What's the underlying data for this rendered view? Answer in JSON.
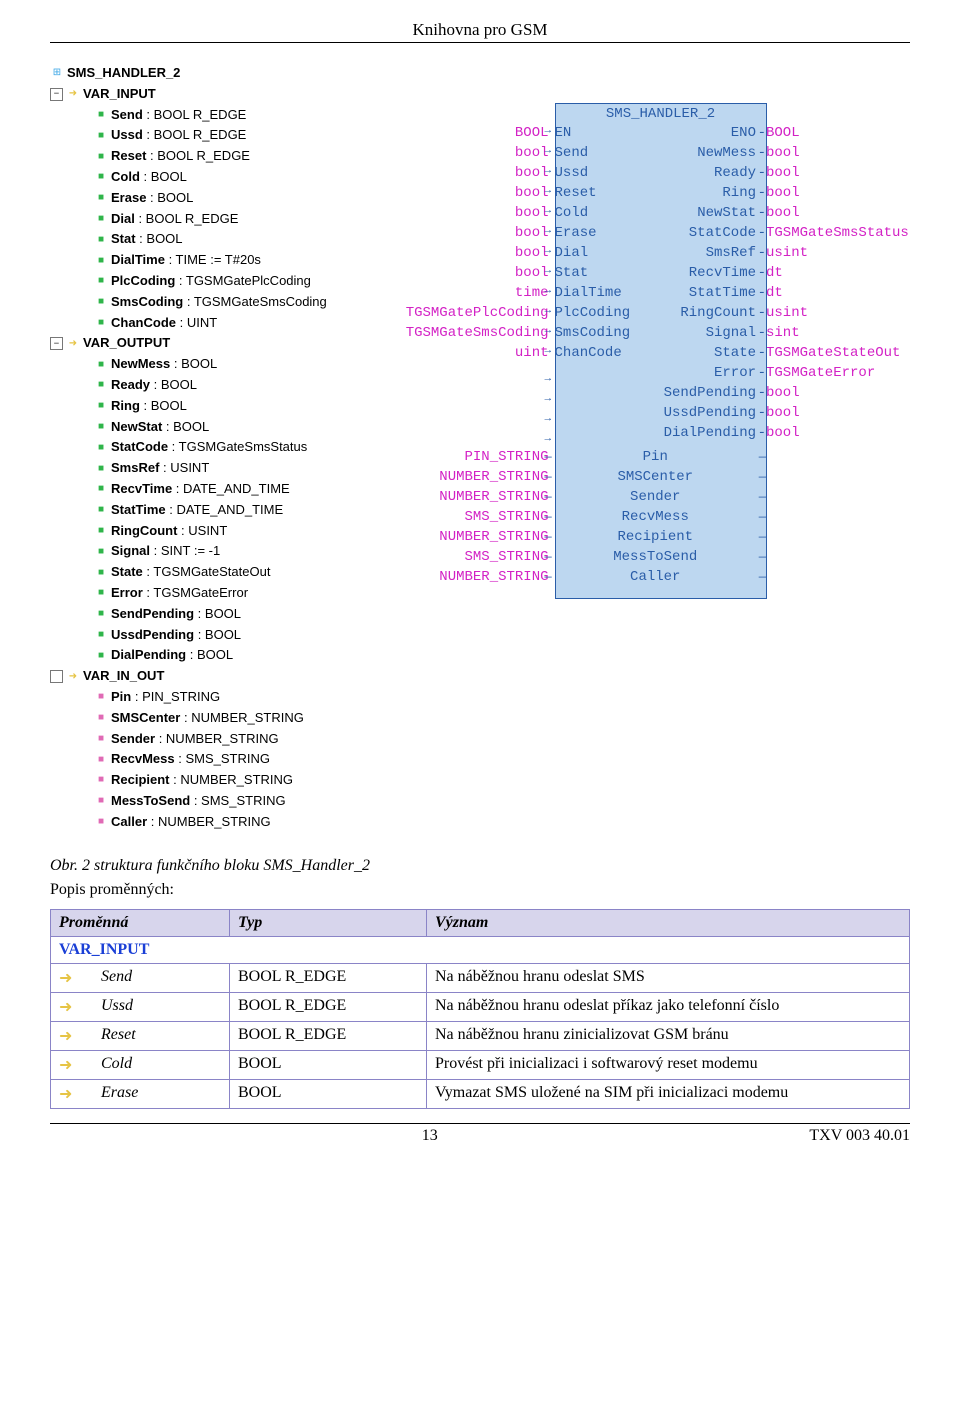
{
  "header": "Knihovna pro GSM",
  "tree": {
    "root": "SMS_HANDLER_2",
    "sections": [
      {
        "label": "VAR_INPUT",
        "items": [
          {
            "name": "Send",
            "type": "BOOL R_EDGE"
          },
          {
            "name": "Ussd",
            "type": "BOOL R_EDGE"
          },
          {
            "name": "Reset",
            "type": "BOOL R_EDGE"
          },
          {
            "name": "Cold",
            "type": "BOOL"
          },
          {
            "name": "Erase",
            "type": "BOOL"
          },
          {
            "name": "Dial",
            "type": "BOOL R_EDGE"
          },
          {
            "name": "Stat",
            "type": "BOOL"
          },
          {
            "name": "DialTime",
            "type": "TIME := T#20s"
          },
          {
            "name": "PlcCoding",
            "type": "TGSMGatePlcCoding"
          },
          {
            "name": "SmsCoding",
            "type": "TGSMGateSmsCoding"
          },
          {
            "name": "ChanCode",
            "type": "UINT"
          }
        ]
      },
      {
        "label": "VAR_OUTPUT",
        "items": [
          {
            "name": "NewMess",
            "type": "BOOL"
          },
          {
            "name": "Ready",
            "type": "BOOL"
          },
          {
            "name": "Ring",
            "type": "BOOL"
          },
          {
            "name": "NewStat",
            "type": "BOOL"
          },
          {
            "name": "StatCode",
            "type": "TGSMGateSmsStatus"
          },
          {
            "name": "SmsRef",
            "type": "USINT"
          },
          {
            "name": "RecvTime",
            "type": "DATE_AND_TIME"
          },
          {
            "name": "StatTime",
            "type": "DATE_AND_TIME"
          },
          {
            "name": "RingCount",
            "type": "USINT"
          },
          {
            "name": "Signal",
            "type": "SINT := -1"
          },
          {
            "name": "State",
            "type": "TGSMGateStateOut"
          },
          {
            "name": "Error",
            "type": "TGSMGateError"
          },
          {
            "name": "SendPending",
            "type": "BOOL"
          },
          {
            "name": "UssdPending",
            "type": "BOOL"
          },
          {
            "name": "DialPending",
            "type": "BOOL"
          }
        ]
      },
      {
        "label": "VAR_IN_OUT",
        "items": [
          {
            "name": "Pin",
            "type": "PIN_STRING"
          },
          {
            "name": "SMSCenter",
            "type": "NUMBER_STRING"
          },
          {
            "name": "Sender",
            "type": "NUMBER_STRING"
          },
          {
            "name": "RecvMess",
            "type": "SMS_STRING"
          },
          {
            "name": "Recipient",
            "type": "NUMBER_STRING"
          },
          {
            "name": "MessToSend",
            "type": "SMS_STRING"
          },
          {
            "name": "Caller",
            "type": "NUMBER_STRING"
          }
        ]
      }
    ]
  },
  "block": {
    "title": "SMS_HANDLER_2",
    "inputs": [
      {
        "type": "BOOL",
        "name": "EN"
      },
      {
        "type": "bool",
        "name": "Send"
      },
      {
        "type": "bool",
        "name": "Ussd"
      },
      {
        "type": "bool",
        "name": "Reset"
      },
      {
        "type": "bool",
        "name": "Cold"
      },
      {
        "type": "bool",
        "name": "Erase"
      },
      {
        "type": "bool",
        "name": "Dial"
      },
      {
        "type": "bool",
        "name": "Stat"
      },
      {
        "type": "time",
        "name": "DialTime"
      },
      {
        "type": "TGSMGatePlcCoding",
        "name": "PlcCoding"
      },
      {
        "type": "TGSMGateSmsCoding",
        "name": "SmsCoding"
      },
      {
        "type": "uint",
        "name": "ChanCode"
      }
    ],
    "outputs": [
      {
        "name": "ENO",
        "type": "BOOL"
      },
      {
        "name": "NewMess",
        "type": "bool"
      },
      {
        "name": "Ready",
        "type": "bool"
      },
      {
        "name": "Ring",
        "type": "bool"
      },
      {
        "name": "NewStat",
        "type": "bool"
      },
      {
        "name": "StatCode",
        "type": "TGSMGateSmsStatus"
      },
      {
        "name": "SmsRef",
        "type": "usint"
      },
      {
        "name": "RecvTime",
        "type": "dt"
      },
      {
        "name": "StatTime",
        "type": "dt"
      },
      {
        "name": "RingCount",
        "type": "usint"
      },
      {
        "name": "Signal",
        "type": "sint"
      },
      {
        "name": "State",
        "type": "TGSMGateStateOut"
      },
      {
        "name": "Error",
        "type": "TGSMGateError"
      },
      {
        "name": "SendPending",
        "type": "bool"
      },
      {
        "name": "UssdPending",
        "type": "bool"
      },
      {
        "name": "DialPending",
        "type": "bool"
      }
    ],
    "inouts": [
      {
        "type": "PIN_STRING",
        "name": "Pin"
      },
      {
        "type": "NUMBER_STRING",
        "name": "SMSCenter"
      },
      {
        "type": "NUMBER_STRING",
        "name": "Sender"
      },
      {
        "type": "SMS_STRING",
        "name": "RecvMess"
      },
      {
        "type": "NUMBER_STRING",
        "name": "Recipient"
      },
      {
        "type": "SMS_STRING",
        "name": "MessToSend"
      },
      {
        "type": "NUMBER_STRING",
        "name": "Caller"
      }
    ]
  },
  "caption": "Obr. 2 struktura funkčního bloku SMS_Handler_2",
  "subhead": "Popis proměnných:",
  "table": {
    "headers": [
      "Proměnná",
      "Typ",
      "Význam"
    ],
    "section": "VAR_INPUT",
    "rows": [
      {
        "name": "Send",
        "type": "BOOL R_EDGE",
        "meaning": "Na náběžnou hranu odeslat SMS"
      },
      {
        "name": "Ussd",
        "type": "BOOL R_EDGE",
        "meaning": "Na náběžnou hranu odeslat příkaz jako telefonní číslo"
      },
      {
        "name": "Reset",
        "type": "BOOL R_EDGE",
        "meaning": "Na náběžnou hranu zinicializovat GSM bránu"
      },
      {
        "name": "Cold",
        "type": "BOOL",
        "meaning": "Provést při inicializaci i softwarový reset modemu"
      },
      {
        "name": "Erase",
        "type": "BOOL",
        "meaning": "Vymazat SMS uložené na SIM při inicializaci modemu"
      }
    ]
  },
  "footer": {
    "page": "13",
    "doc": "TXV 003 40.01"
  }
}
